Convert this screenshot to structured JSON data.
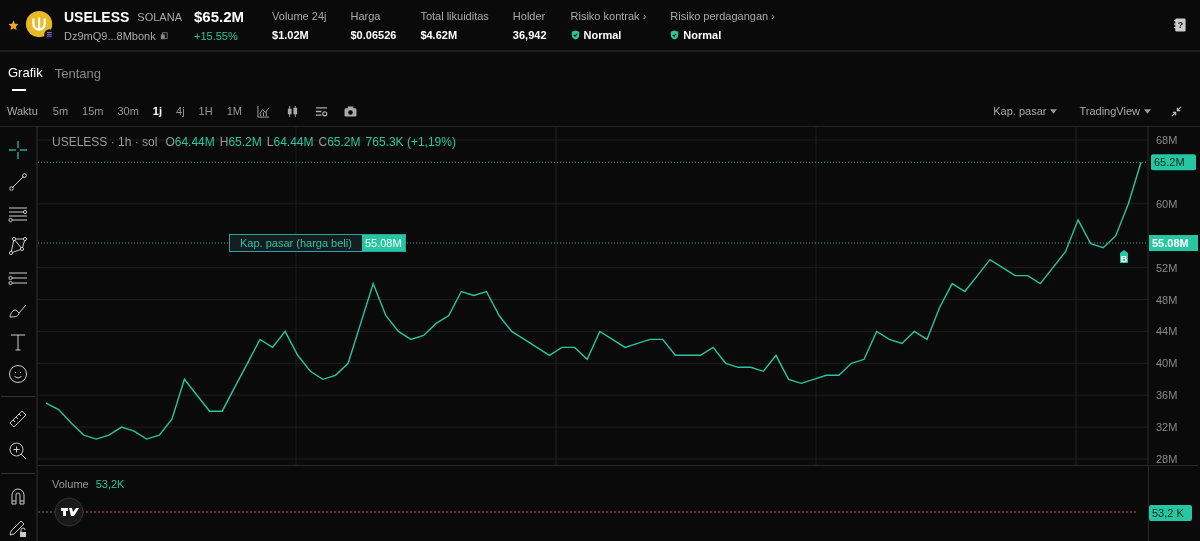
{
  "header": {
    "favorite": true,
    "token": {
      "name": "USELESS",
      "chain": "SOLANA",
      "address": "Dz9mQ9...8Mbonk"
    },
    "price": "$65.2M",
    "change": "+15.55%",
    "stats": [
      {
        "kind": "value",
        "label": "Volume 24j",
        "value": "$1.02M"
      },
      {
        "kind": "value",
        "label": "Harga",
        "value": "$0.06526"
      },
      {
        "kind": "value",
        "label": "Total likuiditas",
        "value": "$4.62M"
      },
      {
        "kind": "value",
        "label": "Holder",
        "value": "36,942"
      },
      {
        "kind": "risk",
        "label": "Risiko kontrak ›",
        "value": "Normal"
      },
      {
        "kind": "risk",
        "label": "Risiko perdagangan ›",
        "value": "Normal"
      }
    ],
    "help": "?"
  },
  "tabs": [
    {
      "label": "Grafik",
      "selected": true
    },
    {
      "label": "Tentang",
      "selected": false
    }
  ],
  "toolbar": {
    "label": "Waktu",
    "intervals": [
      {
        "label": "5m",
        "selected": false
      },
      {
        "label": "15m",
        "selected": false
      },
      {
        "label": "30m",
        "selected": false
      },
      {
        "label": "1j",
        "selected": true
      },
      {
        "label": "4j",
        "selected": false
      },
      {
        "label": "1H",
        "selected": false
      },
      {
        "label": "1M",
        "selected": false
      }
    ],
    "metric": "Kap. pasar",
    "source": "TradingView"
  },
  "chart": {
    "legend": {
      "title": "USELESS · 1h · sol",
      "fields": [
        {
          "key": "O",
          "value": "64.44M"
        },
        {
          "key": "H",
          "value": "65.2M"
        },
        {
          "key": "L",
          "value": "64.44M"
        },
        {
          "key": "C",
          "value": "65.2M"
        }
      ],
      "change": "765.3K (+1,19%)"
    },
    "buy_line": {
      "label": "Kap. pasar (harga beli)",
      "value": "55.08M"
    },
    "marker": "B",
    "chart_data": {
      "type": "line",
      "ylim": [
        27.25,
        69.63
      ],
      "grid": true,
      "ref_lines": [
        {
          "axis": "y",
          "value": 65.2,
          "label": "65.2M"
        },
        {
          "axis": "y",
          "value": 55.08,
          "label": "55.08M"
        }
      ],
      "yticks": [
        {
          "value": 28,
          "label": "28M"
        },
        {
          "value": 32,
          "label": "32M"
        },
        {
          "value": 36,
          "label": "36M"
        },
        {
          "value": 40,
          "label": "40M"
        },
        {
          "value": 44,
          "label": "44M"
        },
        {
          "value": 48,
          "label": "48M"
        },
        {
          "value": 52,
          "label": "52M"
        },
        {
          "value": 60,
          "label": "60M"
        },
        {
          "value": 68,
          "label": "68M"
        }
      ],
      "series": [
        {
          "color": "#26c6a0",
          "values": [
            35,
            34.2,
            32.5,
            31,
            30.5,
            31,
            32,
            31.5,
            30.5,
            31,
            33,
            38,
            36,
            34,
            34,
            37,
            40,
            43,
            42,
            44,
            41,
            39,
            38,
            38.5,
            40,
            45,
            50,
            46,
            44,
            43,
            43.5,
            45,
            46,
            49,
            48.5,
            49,
            46,
            44,
            43,
            42,
            41,
            42,
            42,
            40.5,
            44,
            43,
            42,
            42.5,
            43,
            43,
            41,
            41,
            41,
            42,
            40,
            39.5,
            39.5,
            39,
            41,
            38,
            37.5,
            38,
            38.5,
            38.5,
            40,
            40.5,
            44,
            43,
            42.5,
            44,
            43,
            47,
            50,
            49,
            51,
            53,
            52,
            51,
            51,
            50,
            52,
            54,
            58,
            55,
            54.5,
            56,
            60,
            65.2
          ]
        }
      ]
    }
  },
  "volume": {
    "label": "Volume",
    "value": "53,2K",
    "axis_value": "53,2 K"
  }
}
